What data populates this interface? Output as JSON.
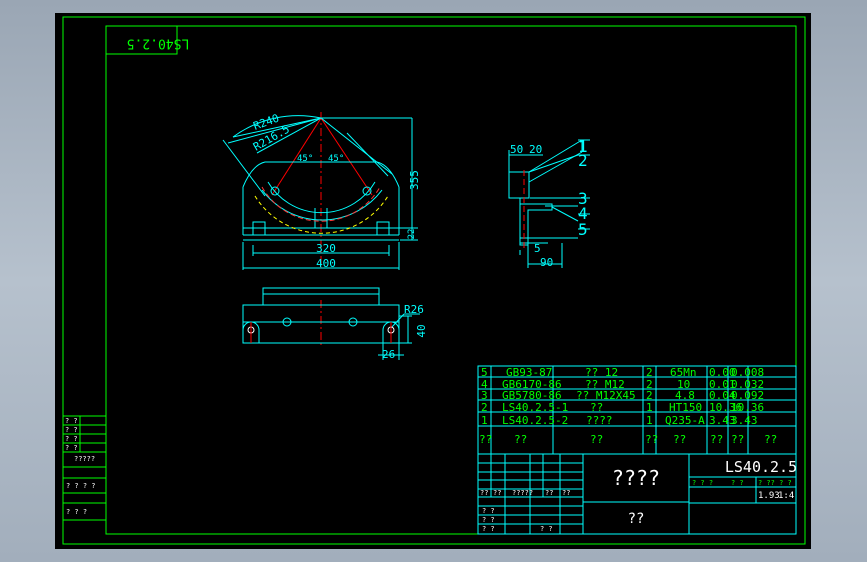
{
  "drawing": {
    "number_mirrored": "LS40.2.5",
    "title_drawing_number": "LS40.2.5",
    "title_name": "????",
    "title_subtitle": "??",
    "scale": "1:4",
    "sheet_info": "1.93",
    "title_small_labels": [
      "? ? ?",
      "? ?",
      "? ?? ? ?"
    ]
  },
  "dimensions": {
    "front": [
      "R240",
      "R216.5",
      "45°",
      "45°",
      "355",
      "22",
      "320",
      "400"
    ],
    "plan": [
      "R26",
      "40",
      "26"
    ],
    "section": [
      "50",
      "20",
      "5",
      "90"
    ]
  },
  "balloons": [
    "1",
    "2",
    "3",
    "4",
    "5"
  ],
  "bom": {
    "rows": [
      {
        "no": "5",
        "code": "GB93-87",
        "name": "?? 12",
        "qty": "2",
        "material": "65Mn",
        "w1": "0.00",
        "w2": "0.008"
      },
      {
        "no": "4",
        "code": "GB6170-86",
        "name": "?? M12",
        "qty": "2",
        "material": "10",
        "w1": "0.01",
        "w2": "0.032"
      },
      {
        "no": "3",
        "code": "GB5780-86",
        "name": "?? M12X45",
        "qty": "2",
        "material": "4.8",
        "w1": "0.04",
        "w2": "0.092"
      },
      {
        "no": "2",
        "code": "LS40.2.5-1",
        "name": "??",
        "qty": "1",
        "material": "HT150",
        "w1": "10.36",
        "w2": "10.36"
      },
      {
        "no": "1",
        "code": "LS40.2.5-2",
        "name": "????",
        "qty": "1",
        "material": "Q235-A",
        "w1": "3.43",
        "w2": "3.43"
      }
    ],
    "header": [
      "??",
      "??",
      "??",
      "??",
      "??",
      "??",
      "??"
    ]
  },
  "left_strip": [
    "? ?",
    "? ?",
    "? ?",
    "? ?",
    "?????",
    "? ? ? ?",
    "? ? ?"
  ],
  "title_block_left": [
    "??",
    "??",
    "?????",
    "??",
    "??",
    "? ?",
    "? ?",
    "? ?",
    "? ?"
  ],
  "colors": {
    "background": "#000000",
    "frame": "#00ff00",
    "geometry": "#00ffff",
    "text": "#00ff00",
    "dimension_text": "#00ffff",
    "centerline": "#ff0000",
    "hidden": "#ffff00",
    "thread": "#ffffff"
  }
}
